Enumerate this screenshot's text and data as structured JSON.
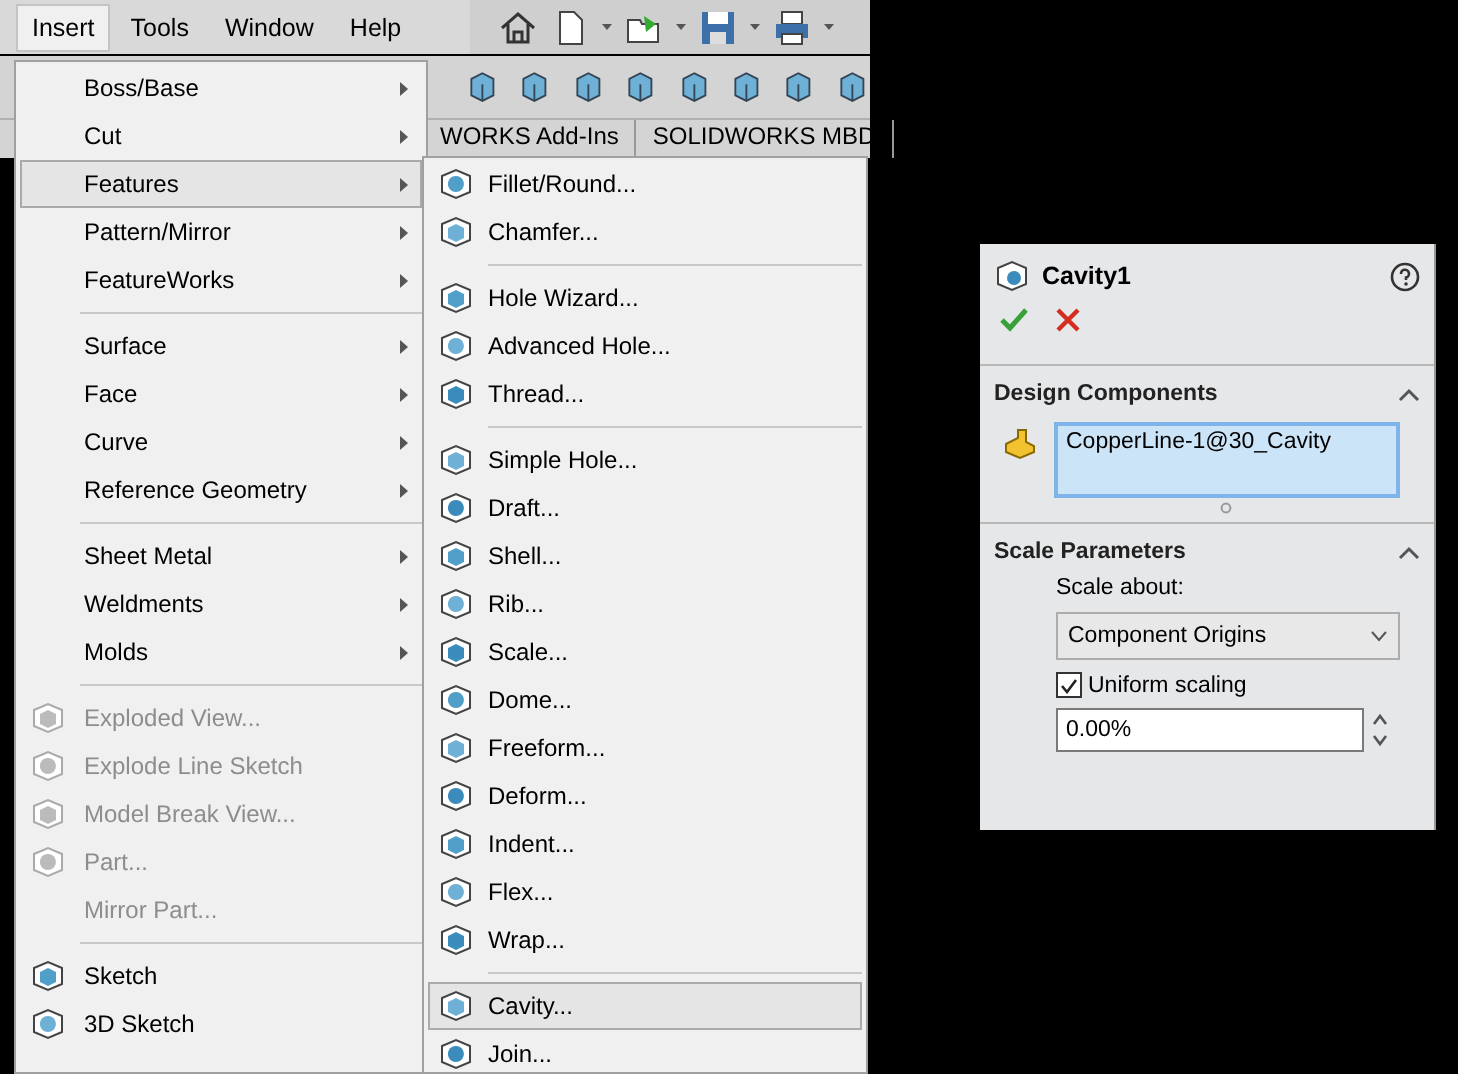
{
  "menubar": {
    "items": [
      {
        "label": "Insert",
        "selected": true
      },
      {
        "label": "Tools",
        "selected": false
      },
      {
        "label": "Window",
        "selected": false
      },
      {
        "label": "Help",
        "selected": false
      }
    ]
  },
  "tabs": [
    {
      "label": "WORKS Add-Ins"
    },
    {
      "label": "SOLIDWORKS MBD"
    }
  ],
  "insert_menu": {
    "items": [
      {
        "kind": "item",
        "label": "Boss/Base",
        "submenu": true,
        "selected": false,
        "disabled": false,
        "icon": false
      },
      {
        "kind": "item",
        "label": "Cut",
        "submenu": true,
        "selected": false,
        "disabled": false,
        "icon": false
      },
      {
        "kind": "item",
        "label": "Features",
        "submenu": true,
        "selected": true,
        "disabled": false,
        "icon": false
      },
      {
        "kind": "item",
        "label": "Pattern/Mirror",
        "submenu": true,
        "selected": false,
        "disabled": false,
        "icon": false
      },
      {
        "kind": "item",
        "label": "FeatureWorks",
        "submenu": true,
        "selected": false,
        "disabled": false,
        "icon": false
      },
      {
        "kind": "separator"
      },
      {
        "kind": "item",
        "label": "Surface",
        "submenu": true,
        "selected": false,
        "disabled": false,
        "icon": false
      },
      {
        "kind": "item",
        "label": "Face",
        "submenu": true,
        "selected": false,
        "disabled": false,
        "icon": false
      },
      {
        "kind": "item",
        "label": "Curve",
        "submenu": true,
        "selected": false,
        "disabled": false,
        "icon": false
      },
      {
        "kind": "item",
        "label": "Reference Geometry",
        "submenu": true,
        "selected": false,
        "disabled": false,
        "icon": false
      },
      {
        "kind": "separator"
      },
      {
        "kind": "item",
        "label": "Sheet Metal",
        "submenu": true,
        "selected": false,
        "disabled": false,
        "icon": false
      },
      {
        "kind": "item",
        "label": "Weldments",
        "submenu": true,
        "selected": false,
        "disabled": false,
        "icon": false
      },
      {
        "kind": "item",
        "label": "Molds",
        "submenu": true,
        "selected": false,
        "disabled": false,
        "icon": false
      },
      {
        "kind": "separator"
      },
      {
        "kind": "item",
        "label": "Exploded View...",
        "submenu": false,
        "selected": false,
        "disabled": true,
        "icon": true
      },
      {
        "kind": "item",
        "label": "Explode Line Sketch",
        "submenu": false,
        "selected": false,
        "disabled": true,
        "icon": true
      },
      {
        "kind": "item",
        "label": "Model Break View...",
        "submenu": false,
        "selected": false,
        "disabled": true,
        "icon": true
      },
      {
        "kind": "item",
        "label": "Part...",
        "submenu": false,
        "selected": false,
        "disabled": true,
        "icon": true
      },
      {
        "kind": "item",
        "label": "Mirror Part...",
        "submenu": false,
        "selected": false,
        "disabled": true,
        "icon": false
      },
      {
        "kind": "separator"
      },
      {
        "kind": "item",
        "label": "Sketch",
        "submenu": false,
        "selected": false,
        "disabled": false,
        "icon": true
      },
      {
        "kind": "item",
        "label": "3D Sketch",
        "submenu": false,
        "selected": false,
        "disabled": false,
        "icon": true
      }
    ]
  },
  "features_menu": {
    "items": [
      {
        "kind": "item",
        "label": "Fillet/Round...",
        "selected": false
      },
      {
        "kind": "item",
        "label": "Chamfer...",
        "selected": false
      },
      {
        "kind": "separator"
      },
      {
        "kind": "item",
        "label": "Hole Wizard...",
        "selected": false
      },
      {
        "kind": "item",
        "label": "Advanced Hole...",
        "selected": false
      },
      {
        "kind": "item",
        "label": "Thread...",
        "selected": false
      },
      {
        "kind": "separator"
      },
      {
        "kind": "item",
        "label": "Simple Hole...",
        "selected": false
      },
      {
        "kind": "item",
        "label": "Draft...",
        "selected": false
      },
      {
        "kind": "item",
        "label": "Shell...",
        "selected": false
      },
      {
        "kind": "item",
        "label": "Rib...",
        "selected": false
      },
      {
        "kind": "item",
        "label": "Scale...",
        "selected": false
      },
      {
        "kind": "item",
        "label": "Dome...",
        "selected": false
      },
      {
        "kind": "item",
        "label": "Freeform...",
        "selected": false
      },
      {
        "kind": "item",
        "label": "Deform...",
        "selected": false
      },
      {
        "kind": "item",
        "label": "Indent...",
        "selected": false
      },
      {
        "kind": "item",
        "label": "Flex...",
        "selected": false
      },
      {
        "kind": "item",
        "label": "Wrap...",
        "selected": false
      },
      {
        "kind": "separator"
      },
      {
        "kind": "item",
        "label": "Cavity...",
        "selected": true
      },
      {
        "kind": "item",
        "label": "Join...",
        "selected": false
      }
    ]
  },
  "property_panel": {
    "title": "Cavity1",
    "design_components": {
      "heading": "Design Components",
      "expanded": true,
      "value": "CopperLine-1@30_Cavity"
    },
    "scale_parameters": {
      "heading": "Scale Parameters",
      "expanded": true,
      "scale_about_label": "Scale about:",
      "scale_about": "Component Origins",
      "uniform_scaling": {
        "label": "Uniform scaling",
        "checked": true
      },
      "scale_value": "0.00%"
    }
  }
}
